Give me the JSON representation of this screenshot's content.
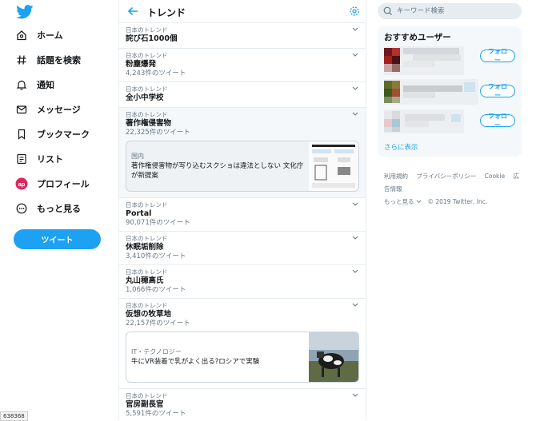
{
  "nav": {
    "items": [
      {
        "label": "ホーム",
        "icon": "home-icon"
      },
      {
        "label": "話題を検索",
        "icon": "hashtag-icon"
      },
      {
        "label": "通知",
        "icon": "bell-icon"
      },
      {
        "label": "メッセージ",
        "icon": "mail-icon"
      },
      {
        "label": "ブックマーク",
        "icon": "bookmark-icon"
      },
      {
        "label": "リスト",
        "icon": "list-icon"
      },
      {
        "label": "プロフィール",
        "icon": "profile-avatar-icon"
      },
      {
        "label": "もっと見る",
        "icon": "more-icon"
      }
    ],
    "tweet_button": "ツイート",
    "brand_color": "#1da1f2"
  },
  "header": {
    "title": "トレンド"
  },
  "trends": [
    {
      "loc": "日本のトレンド",
      "name": "詫び石1000個",
      "count": ""
    },
    {
      "loc": "日本のトレンド",
      "name": "粉塵爆発",
      "count": "4,243件のツイート"
    },
    {
      "loc": "日本のトレンド",
      "name": "全小中学校",
      "count": ""
    },
    {
      "loc": "日本のトレンド",
      "name": "著作権侵害物",
      "count": "22,325件のツイート",
      "card": {
        "category": "国内",
        "title": "著作権侵害物が写り込むスクショは違法としない 文化庁が新提案"
      }
    },
    {
      "loc": "日本のトレンド",
      "name": "Portal",
      "count": "90,071件のツイート"
    },
    {
      "loc": "日本のトレンド",
      "name": "休眠垢削除",
      "count": "3,410件のツイート"
    },
    {
      "loc": "日本のトレンド",
      "name": "丸山穂高氏",
      "count": "1,066件のツイート"
    },
    {
      "loc": "日本のトレンド",
      "name": "仮想の牧草地",
      "count": "22,157件のツイート",
      "card": {
        "category": "IT・テクノロジー",
        "title": "牛にVR装着で乳がよく出る?ロシアで実験"
      }
    },
    {
      "loc": "日本のトレンド",
      "name": "官房副長官",
      "count": "5,591件のツイート"
    }
  ],
  "search": {
    "placeholder": "キーワード検索"
  },
  "who_to_follow": {
    "title": "おすすめユーザー",
    "follow_label": "フォロー",
    "more_label": "さらに表示"
  },
  "footer": {
    "links": [
      "利用規約",
      "プライバシーポリシー",
      "Cookie",
      "広告情報",
      "もっと見る"
    ],
    "copyright": "© 2019 Twitter, Inc."
  },
  "statusbar": {
    "text": "638368"
  }
}
